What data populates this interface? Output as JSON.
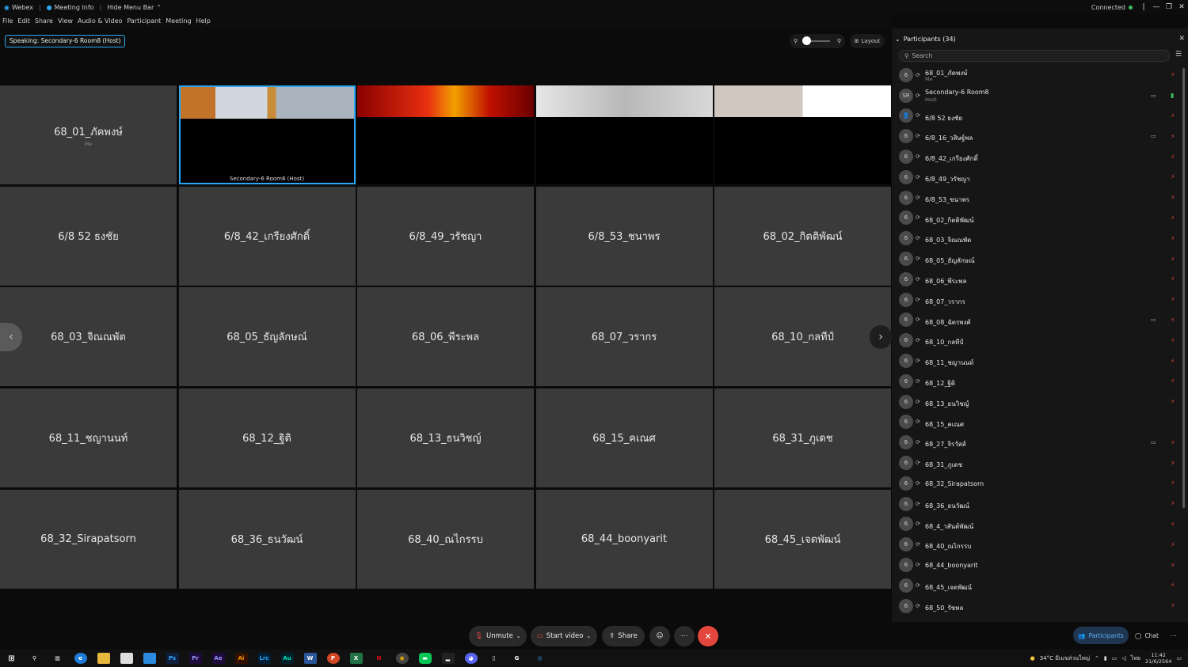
{
  "titlebar": {
    "app": "Webex",
    "meeting_info": "Meeting Info",
    "hide_menu": "Hide Menu Bar",
    "status": "Connected"
  },
  "menu": [
    "File",
    "Edit",
    "Share",
    "View",
    "Audio & Video",
    "Participant",
    "Meeting",
    "Help"
  ],
  "speaking": "Speaking: Secondary-6 Room8 (Host)",
  "layout_label": "Layout",
  "tiles": [
    {
      "name": "68_01_ภัคพงษ์",
      "sub": "Me",
      "kind": "avatar"
    },
    {
      "name": "Secondary-6 Room8  (Host)",
      "kind": "video-host"
    },
    {
      "name": "",
      "kind": "video"
    },
    {
      "name": "",
      "kind": "video"
    },
    {
      "name": "",
      "kind": "video"
    },
    {
      "name": "6/8 52 ธงชัย",
      "kind": "avatar"
    },
    {
      "name": "6/8_42_เกรียงศักดิ์",
      "kind": "avatar"
    },
    {
      "name": "6/8_49_วรัชญา",
      "kind": "avatar"
    },
    {
      "name": "6/8_53_ชนาพร",
      "kind": "avatar"
    },
    {
      "name": "68_02_กิตติพัฒน์",
      "kind": "avatar"
    },
    {
      "name": "68_03_จิณณพัต",
      "kind": "avatar"
    },
    {
      "name": "68_05_ธัญลักษณ์",
      "kind": "avatar"
    },
    {
      "name": "68_06_พีระพล",
      "kind": "avatar"
    },
    {
      "name": "68_07_วรากร",
      "kind": "avatar"
    },
    {
      "name": "68_10_กลทีป์",
      "kind": "avatar"
    },
    {
      "name": "68_11_ชญานนท์",
      "kind": "avatar"
    },
    {
      "name": "68_12_ฐิติ",
      "kind": "avatar"
    },
    {
      "name": "68_13_ธนวิชญ์",
      "kind": "avatar"
    },
    {
      "name": "68_15_คเณศ",
      "kind": "avatar"
    },
    {
      "name": "68_31_ภูเดช",
      "kind": "avatar"
    },
    {
      "name": "68_32_Sirapatsorn",
      "kind": "avatar"
    },
    {
      "name": "68_36_ธนวัฒน์",
      "kind": "avatar"
    },
    {
      "name": "68_40_ณไกรรบ",
      "kind": "avatar"
    },
    {
      "name": "68_44_boonyarit",
      "kind": "avatar"
    },
    {
      "name": "68_45_เจตพัฒน์",
      "kind": "avatar"
    }
  ],
  "controls": {
    "unmute": "Unmute",
    "start_video": "Start video",
    "share": "Share"
  },
  "panel": {
    "title": "Participants (34)",
    "search_placeholder": "Search",
    "participants": [
      {
        "avatar": "6",
        "name": "68_01_ภัคพงษ์",
        "role": "Me",
        "cam": false,
        "mic": "muted"
      },
      {
        "avatar": "SR",
        "name": "Secondary-6 Room8",
        "role": "Host",
        "cam": true,
        "mic": "on"
      },
      {
        "avatar": "👤",
        "name": "6/8 52 ธงชัย",
        "role": "",
        "cam": false,
        "mic": "muted"
      },
      {
        "avatar": "6",
        "name": "6/8_16_วสิษฐ์พล",
        "role": "",
        "cam": true,
        "mic": "muted"
      },
      {
        "avatar": "6",
        "name": "6/8_42_เกรียงศักดิ์",
        "role": "",
        "cam": false,
        "mic": "muted"
      },
      {
        "avatar": "6",
        "name": "6/8_49_วรัชญา",
        "role": "",
        "cam": false,
        "mic": "muted"
      },
      {
        "avatar": "6",
        "name": "6/8_53_ชนาพร",
        "role": "",
        "cam": false,
        "mic": "muted"
      },
      {
        "avatar": "6",
        "name": "68_02_กิตติพัฒน์",
        "role": "",
        "cam": false,
        "mic": "muted"
      },
      {
        "avatar": "6",
        "name": "68_03_จิณณพัต",
        "role": "",
        "cam": false,
        "mic": "muted"
      },
      {
        "avatar": "6",
        "name": "68_05_ธัญลักษณ์",
        "role": "",
        "cam": false,
        "mic": "muted"
      },
      {
        "avatar": "6",
        "name": "68_06_พีระพล",
        "role": "",
        "cam": false,
        "mic": "muted"
      },
      {
        "avatar": "6",
        "name": "68_07_วรากร",
        "role": "",
        "cam": false,
        "mic": "muted"
      },
      {
        "avatar": "6",
        "name": "68_08_ฉัตรพงศ์",
        "role": "",
        "cam": true,
        "mic": "muted"
      },
      {
        "avatar": "6",
        "name": "68_10_กลทีป์",
        "role": "",
        "cam": false,
        "mic": "muted"
      },
      {
        "avatar": "6",
        "name": "68_11_ชญานนท์",
        "role": "",
        "cam": false,
        "mic": "muted"
      },
      {
        "avatar": "6",
        "name": "68_12_ฐิติ",
        "role": "",
        "cam": false,
        "mic": "muted"
      },
      {
        "avatar": "6",
        "name": "68_13_ธนวิชญ์",
        "role": "",
        "cam": false,
        "mic": "muted"
      },
      {
        "avatar": "6",
        "name": "68_15_คเณศ",
        "role": "",
        "cam": false,
        "mic": "none"
      },
      {
        "avatar": "6",
        "name": "68_27_จิรวัสส์",
        "role": "",
        "cam": true,
        "mic": "muted"
      },
      {
        "avatar": "6",
        "name": "68_31_ภูเดช",
        "role": "",
        "cam": false,
        "mic": "muted"
      },
      {
        "avatar": "6",
        "name": "68_32_Sirapatsorn",
        "role": "",
        "cam": false,
        "mic": "muted"
      },
      {
        "avatar": "6",
        "name": "68_36_ธนวัฒน์",
        "role": "",
        "cam": false,
        "mic": "muted"
      },
      {
        "avatar": "6",
        "name": "68_4_วสันต์พัฒน์",
        "role": "",
        "cam": false,
        "mic": "muted"
      },
      {
        "avatar": "6",
        "name": "68_40_ณไกรรบ",
        "role": "",
        "cam": false,
        "mic": "muted"
      },
      {
        "avatar": "6",
        "name": "68_44_boonyarit",
        "role": "",
        "cam": false,
        "mic": "muted"
      },
      {
        "avatar": "6",
        "name": "68_45_เจตพัฒน์",
        "role": "",
        "cam": false,
        "mic": "muted"
      },
      {
        "avatar": "6",
        "name": "68_50_รัชพล",
        "role": "",
        "cam": false,
        "mic": "muted"
      }
    ],
    "participants_tab": "Participants",
    "chat_tab": "Chat"
  },
  "taskbar": {
    "weather": "34°C มีเมฆส่วนใหญ่",
    "lang": "ไทย",
    "time": "11:42",
    "date": "21/6/2564"
  },
  "colors": {
    "accent": "#2ea7f0",
    "mute": "#e2463d",
    "ok": "#3fbf5a"
  }
}
